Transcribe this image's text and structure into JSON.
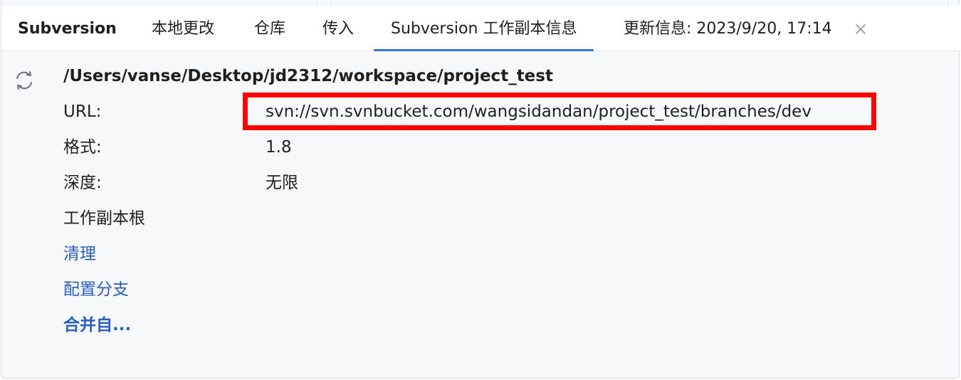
{
  "tabs": {
    "title": "Subversion",
    "local_changes": "本地更改",
    "repository": "仓库",
    "incoming": "传入",
    "working_copy_info": "Subversion 工作副本信息",
    "update_info": "更新信息: 2023/9/20, 17:14"
  },
  "info": {
    "path": "/Users/vanse/Desktop/jd2312/workspace/project_test",
    "url_label": "URL:",
    "url_value": "svn://svn.svnbucket.com/wangsidandan/project_test/branches/dev",
    "format_label": "格式:",
    "format_value": "1.8",
    "depth_label": "深度:",
    "depth_value": "无限",
    "wc_root_label": "工作副本根"
  },
  "actions": {
    "cleanup": "清理",
    "configure_branches": "配置分支",
    "merge_from": "合并自..."
  },
  "colors": {
    "accent": "#3574f0",
    "link": "#2a5dbd",
    "highlight_box": "#ff0000"
  }
}
